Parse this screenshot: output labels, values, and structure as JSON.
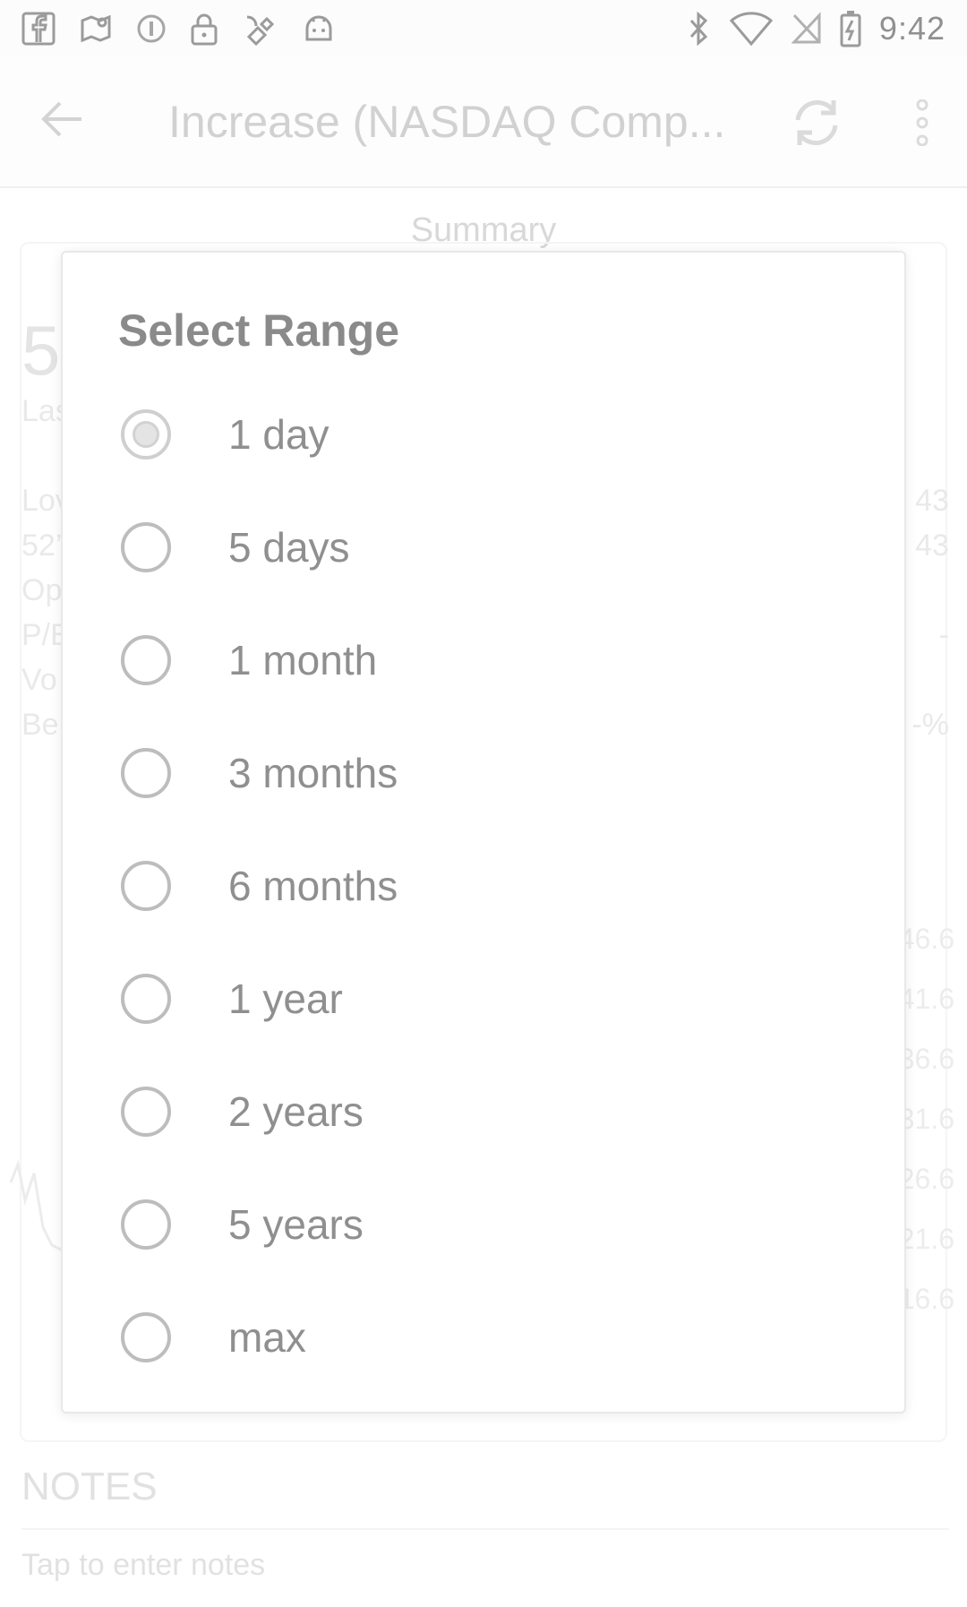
{
  "status_bar": {
    "time": "9:42",
    "left_icons": [
      "facebook-icon",
      "maps-icon",
      "circle-i-icon",
      "lock-icon",
      "satellite-icon",
      "android-icon"
    ],
    "right_icons": [
      "bluetooth-icon",
      "wifi-icon",
      "no-sim-icon",
      "battery-charging-icon"
    ]
  },
  "app_bar": {
    "title": "Increase (NASDAQ Comp...",
    "back_icon": "arrow-left-icon",
    "refresh_icon": "refresh-icon",
    "menu_icon": "more-vert-icon"
  },
  "background": {
    "summary_label": "Summary",
    "price_partial": "5",
    "last_partial": "Las",
    "stats_left": [
      "Lov",
      "52’",
      "Op",
      "P/E",
      "Vo",
      "Be"
    ],
    "stats_right": [
      "43",
      "43",
      "-",
      "-%"
    ],
    "axis_values": [
      "46.6",
      "41.6",
      "36.6",
      "31.6",
      "26.6",
      "21.6",
      "16.6"
    ],
    "notes_title": "NOTES",
    "notes_placeholder": "Tap to enter notes"
  },
  "dialog": {
    "title": "Select Range",
    "selected_index": 0,
    "options": [
      {
        "label": "1 day"
      },
      {
        "label": "5 days"
      },
      {
        "label": "1 month"
      },
      {
        "label": "3 months"
      },
      {
        "label": "6 months"
      },
      {
        "label": "1 year"
      },
      {
        "label": "2 years"
      },
      {
        "label": "5 years"
      },
      {
        "label": "max"
      }
    ]
  }
}
